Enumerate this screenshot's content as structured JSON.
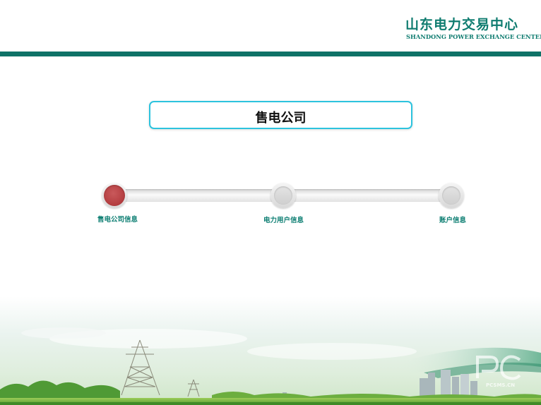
{
  "header": {
    "logo_cn": "山东电力交易中心",
    "logo_en": "SHANDONG POWER EXCHANGE CENTER"
  },
  "title": "售电公司",
  "steps": [
    {
      "label": "售电公司信息",
      "active": true
    },
    {
      "label": "电力用户信息",
      "active": false
    },
    {
      "label": "账户信息",
      "active": false
    }
  ],
  "colors": {
    "brand": "#0f7267",
    "accent": "#2cc3de",
    "active_step": "#b8474a"
  },
  "watermark": "PCSMS.CN"
}
